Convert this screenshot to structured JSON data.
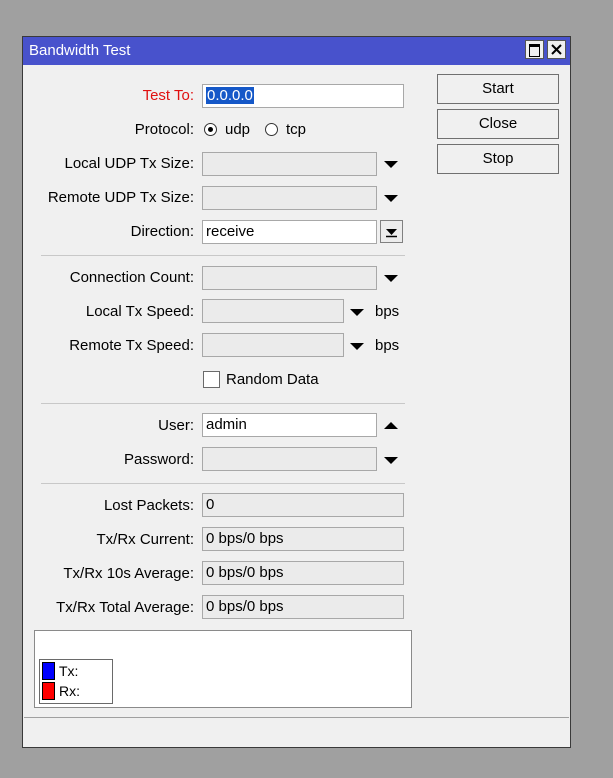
{
  "window": {
    "title": "Bandwidth Test"
  },
  "form": {
    "test_to": {
      "label": "Test To:",
      "value": "0.0.0.0"
    },
    "protocol": {
      "label": "Protocol:",
      "options": [
        {
          "label": "udp",
          "checked": true
        },
        {
          "label": "tcp",
          "checked": false
        }
      ]
    },
    "local_udp_tx_size": {
      "label": "Local UDP Tx Size:",
      "value": ""
    },
    "remote_udp_tx_size": {
      "label": "Remote UDP Tx Size:",
      "value": ""
    },
    "direction": {
      "label": "Direction:",
      "value": "receive"
    },
    "connection_count": {
      "label": "Connection Count:",
      "value": ""
    },
    "local_tx_speed": {
      "label": "Local Tx Speed:",
      "value": "",
      "unit": "bps"
    },
    "remote_tx_speed": {
      "label": "Remote Tx Speed:",
      "value": "",
      "unit": "bps"
    },
    "random_data": {
      "label": "Random Data",
      "checked": false
    },
    "user": {
      "label": "User:",
      "value": "admin"
    },
    "password": {
      "label": "Password:",
      "value": ""
    }
  },
  "stats": {
    "lost_packets": {
      "label": "Lost Packets:",
      "value": "0"
    },
    "txrx_current": {
      "label": "Tx/Rx Current:",
      "value": "0 bps/0 bps"
    },
    "txrx_10s_average": {
      "label": "Tx/Rx 10s Average:",
      "value": "0 bps/0 bps"
    },
    "txrx_total_average": {
      "label": "Tx/Rx Total Average:",
      "value": "0 bps/0 bps"
    }
  },
  "buttons": {
    "start": "Start",
    "close": "Close",
    "stop": "Stop"
  },
  "legend": {
    "tx": {
      "label": "Tx:",
      "color": "#0000ff"
    },
    "rx": {
      "label": "Rx:",
      "color": "#ff0000"
    }
  },
  "colors": {
    "titlebar": "#4852cc",
    "label_highlight": "#e01010",
    "selection": "#1558c8"
  },
  "status": {
    "text": ""
  }
}
